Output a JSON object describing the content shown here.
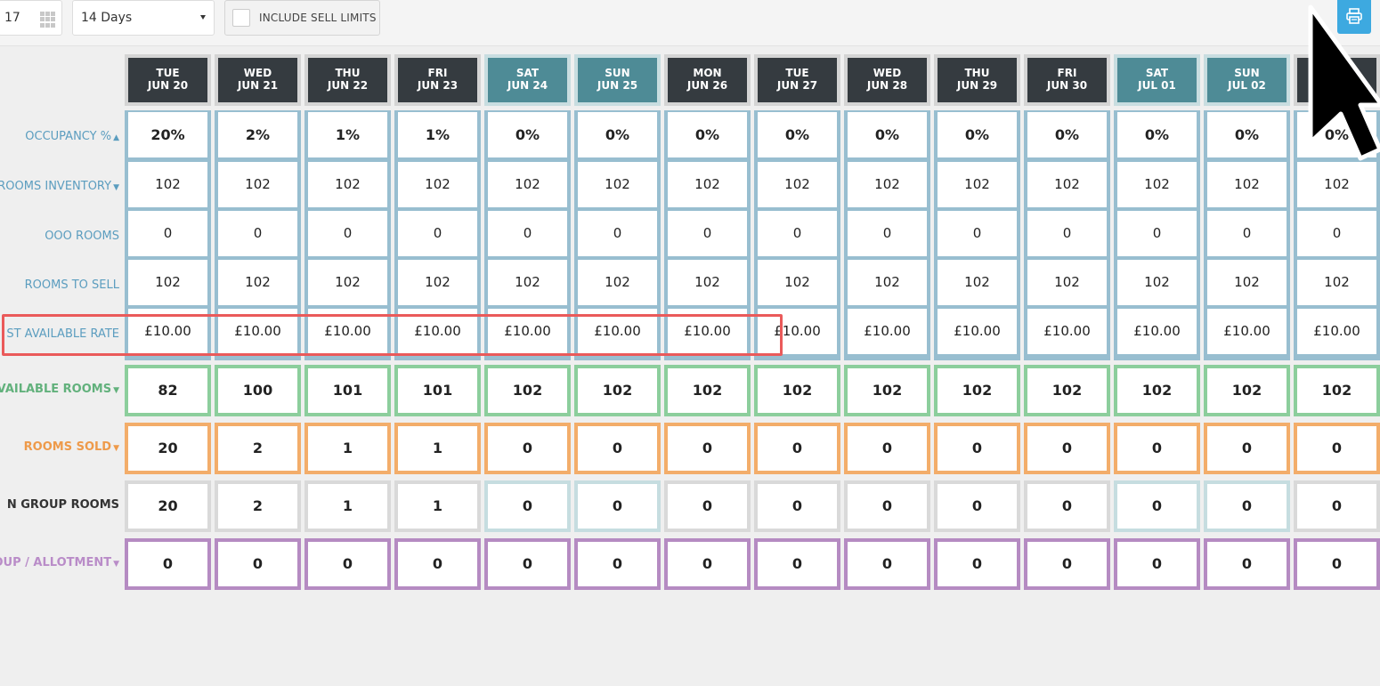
{
  "toolbar": {
    "date_value": "17",
    "days_select": "14 Days",
    "include_sell_limits": "INCLUDE SELL LIMITS",
    "print_icon": "print-icon"
  },
  "columns": [
    {
      "day": "TUE",
      "date": "JUN 20",
      "weekend": false
    },
    {
      "day": "WED",
      "date": "JUN 21",
      "weekend": false
    },
    {
      "day": "THU",
      "date": "JUN 22",
      "weekend": false
    },
    {
      "day": "FRI",
      "date": "JUN 23",
      "weekend": false
    },
    {
      "day": "SAT",
      "date": "JUN 24",
      "weekend": true
    },
    {
      "day": "SUN",
      "date": "JUN 25",
      "weekend": true
    },
    {
      "day": "MON",
      "date": "JUN 26",
      "weekend": false
    },
    {
      "day": "TUE",
      "date": "JUN 27",
      "weekend": false
    },
    {
      "day": "WED",
      "date": "JUN 28",
      "weekend": false
    },
    {
      "day": "THU",
      "date": "JUN 29",
      "weekend": false
    },
    {
      "day": "FRI",
      "date": "JUN 30",
      "weekend": false
    },
    {
      "day": "SAT",
      "date": "JUL 01",
      "weekend": true
    },
    {
      "day": "SUN",
      "date": "JUL 02",
      "weekend": true
    },
    {
      "day": "",
      "date": "",
      "weekend": false
    }
  ],
  "rows": [
    {
      "label": "OCCUPANCY %",
      "arrow": "up",
      "style": "blue",
      "values": [
        "20%",
        "2%",
        "1%",
        "1%",
        "0%",
        "0%",
        "0%",
        "0%",
        "0%",
        "0%",
        "0%",
        "0%",
        "0%",
        "0%"
      ]
    },
    {
      "label": "ROOMS INVENTORY",
      "arrow": "down",
      "style": "blue",
      "values": [
        "102",
        "102",
        "102",
        "102",
        "102",
        "102",
        "102",
        "102",
        "102",
        "102",
        "102",
        "102",
        "102",
        "102"
      ]
    },
    {
      "label": "OOO ROOMS",
      "arrow": "",
      "style": "blue",
      "values": [
        "0",
        "0",
        "0",
        "0",
        "0",
        "0",
        "0",
        "0",
        "0",
        "0",
        "0",
        "0",
        "0",
        "0"
      ]
    },
    {
      "label": "ROOMS TO SELL",
      "arrow": "",
      "style": "blue",
      "values": [
        "102",
        "102",
        "102",
        "102",
        "102",
        "102",
        "102",
        "102",
        "102",
        "102",
        "102",
        "102",
        "102",
        "102"
      ]
    },
    {
      "label": "ST AVAILABLE RATE",
      "arrow": "",
      "style": "blue",
      "values": [
        "£10.00",
        "£10.00",
        "£10.00",
        "£10.00",
        "£10.00",
        "£10.00",
        "£10.00",
        "£10.00",
        "£10.00",
        "£10.00",
        "£10.00",
        "£10.00",
        "£10.00",
        "£10.00"
      ]
    },
    {
      "label": "VAILABLE ROOMS",
      "arrow": "down",
      "style": "green",
      "values": [
        "82",
        "100",
        "101",
        "101",
        "102",
        "102",
        "102",
        "102",
        "102",
        "102",
        "102",
        "102",
        "102",
        "102"
      ]
    },
    {
      "label": "ROOMS SOLD",
      "arrow": "down",
      "style": "orange",
      "values": [
        "20",
        "2",
        "1",
        "1",
        "0",
        "0",
        "0",
        "0",
        "0",
        "0",
        "0",
        "0",
        "0",
        "0"
      ]
    },
    {
      "label": "N GROUP ROOMS",
      "arrow": "",
      "style": "gray",
      "values": [
        "20",
        "2",
        "1",
        "1",
        "0",
        "0",
        "0",
        "0",
        "0",
        "0",
        "0",
        "0",
        "0",
        "0"
      ]
    },
    {
      "label": "OUP / ALLOTMENT",
      "arrow": "down",
      "style": "purple",
      "values": [
        "0",
        "0",
        "0",
        "0",
        "0",
        "0",
        "0",
        "0",
        "0",
        "0",
        "0",
        "0",
        "0",
        "0"
      ]
    }
  ],
  "colors": {
    "blue": "#98bed0",
    "green": "#8cce9c",
    "orange": "#f3ad6a",
    "gray": "#d9d9d9",
    "purple": "#b58bc2",
    "highlight": "#ea5a5a"
  },
  "icons": {
    "up_arrow": "double-chevron-up-icon",
    "down_arrow": "double-chevron-down-icon",
    "cursor": "mouse-cursor-icon"
  }
}
